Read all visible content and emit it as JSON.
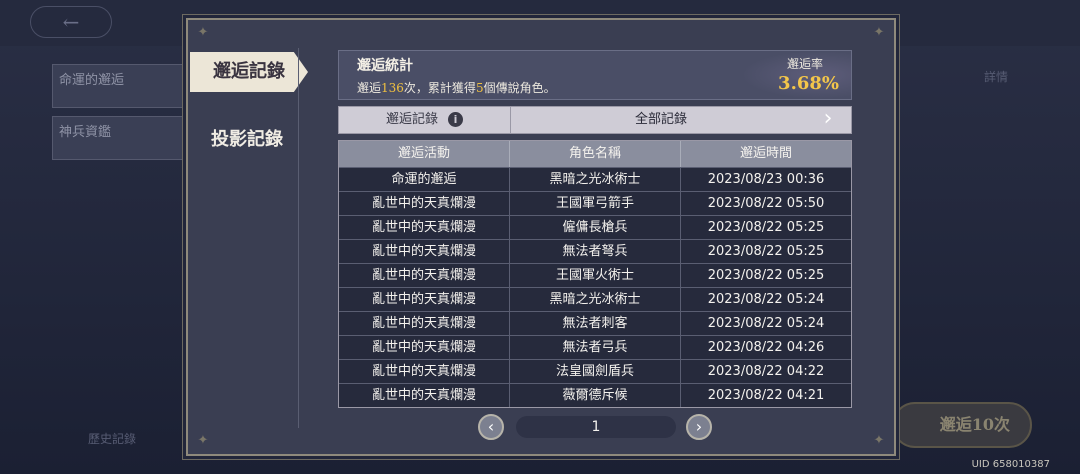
{
  "background": {
    "back_icon": "arrow-left-icon",
    "tile1": "命運的邂逅",
    "tile2": "神兵資鑑",
    "history": "歷史記錄",
    "detail": "詳情",
    "summon_button": "邂逅10次",
    "uid": "UID 658010387"
  },
  "tabs": {
    "active": "邂逅記錄",
    "inactive": "投影記錄"
  },
  "stats": {
    "title": "邂逅統計",
    "desc_prefix": "邂逅",
    "count": "136",
    "desc_mid": "次，累計獲得",
    "legendary": "5",
    "desc_suffix": "個傳說角色。",
    "rate_label": "邂逅率",
    "rate_value": "3.68%"
  },
  "filter": {
    "label": "邂逅記錄",
    "info_icon": "info-icon",
    "selected": "全部記錄",
    "arrow_icon": "chevron-right-icon"
  },
  "table": {
    "headers": [
      "邂逅活動",
      "角色名稱",
      "邂逅時間"
    ],
    "rows": [
      [
        "命運的邂逅",
        "黑暗之光冰術士",
        "2023/08/23 00:36"
      ],
      [
        "亂世中的天真爛漫",
        "王國軍弓箭手",
        "2023/08/22 05:50"
      ],
      [
        "亂世中的天真爛漫",
        "僱傭長槍兵",
        "2023/08/22 05:25"
      ],
      [
        "亂世中的天真爛漫",
        "無法者弩兵",
        "2023/08/22 05:25"
      ],
      [
        "亂世中的天真爛漫",
        "王國軍火術士",
        "2023/08/22 05:25"
      ],
      [
        "亂世中的天真爛漫",
        "黑暗之光冰術士",
        "2023/08/22 05:24"
      ],
      [
        "亂世中的天真爛漫",
        "無法者刺客",
        "2023/08/22 05:24"
      ],
      [
        "亂世中的天真爛漫",
        "無法者弓兵",
        "2023/08/22 04:26"
      ],
      [
        "亂世中的天真爛漫",
        "法皇國劍盾兵",
        "2023/08/22 04:22"
      ],
      [
        "亂世中的天真爛漫",
        "薇爾德斥候",
        "2023/08/22 04:21"
      ]
    ]
  },
  "pagination": {
    "prev_icon": "chevron-left-icon",
    "page": "1",
    "next_icon": "chevron-right-icon"
  }
}
